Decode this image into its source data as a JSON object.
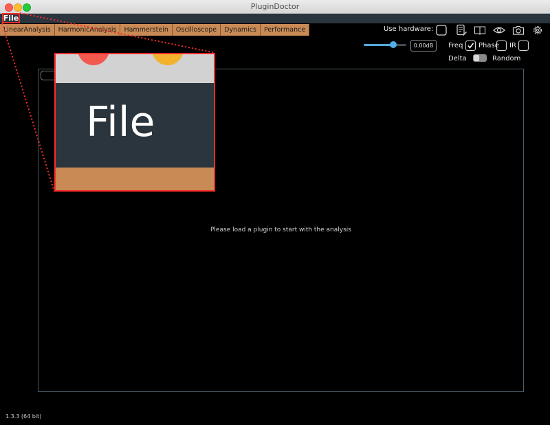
{
  "window": {
    "title": "PluginDoctor"
  },
  "menu": {
    "file": "File"
  },
  "tabs": [
    {
      "label": "LinearAnalysis"
    },
    {
      "label": "HarmonicAnalysis"
    },
    {
      "label": "Hammerstein"
    },
    {
      "label": "Oscilloscope"
    },
    {
      "label": "Dynamics"
    },
    {
      "label": "Performance"
    }
  ],
  "toolbar": {
    "use_hardware_label": "Use hardware:",
    "icons": [
      "checkbox-icon",
      "notes-icon",
      "book-icon",
      "eye-icon",
      "camera-icon",
      "gear-icon"
    ]
  },
  "controls": {
    "gain_value": "0.00dB",
    "gain_level": 0.68,
    "freq_label": "Freq",
    "freq_checked": true,
    "phase_label": "Phase",
    "phase_checked": false,
    "ir_label": "IR",
    "ir_checked": false,
    "delta_label": "Delta",
    "random_label": "Random"
  },
  "main": {
    "message": "Please load a plugin to start with the analysis"
  },
  "footer": {
    "version": "1.3.3 (64 bit)"
  },
  "zoom": {
    "text": "File"
  },
  "colors": {
    "tab": "#c98a55",
    "menubar": "#2b353d",
    "highlight": "#ff2b2b",
    "accent": "#4fb0e6"
  }
}
